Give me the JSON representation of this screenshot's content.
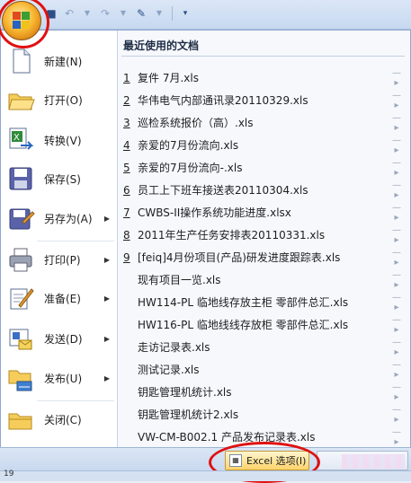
{
  "menu": {
    "items": [
      {
        "label": "新建(N)",
        "icon": "new-document-icon"
      },
      {
        "label": "打开(O)",
        "icon": "open-folder-icon"
      },
      {
        "label": "转换(V)",
        "icon": "convert-icon"
      },
      {
        "label": "保存(S)",
        "icon": "save-disk-icon"
      },
      {
        "label": "另存为(A)",
        "icon": "save-as-icon",
        "submenu": true
      },
      {
        "label": "打印(P)",
        "icon": "printer-icon",
        "submenu": true
      },
      {
        "label": "准备(E)",
        "icon": "prepare-icon",
        "submenu": true
      },
      {
        "label": "发送(D)",
        "icon": "send-icon",
        "submenu": true
      },
      {
        "label": "发布(U)",
        "icon": "publish-icon",
        "submenu": true
      },
      {
        "label": "关闭(C)",
        "icon": "close-folder-icon"
      }
    ]
  },
  "recent": {
    "heading": "最近使用的文档",
    "docs": [
      {
        "num": "1",
        "name": "复件 7月.xls"
      },
      {
        "num": "2",
        "name": "华伟电气内部通讯录20110329.xls"
      },
      {
        "num": "3",
        "name": "巡检系统报价（高）.xls"
      },
      {
        "num": "4",
        "name": "亲爱的7月份流向.xls"
      },
      {
        "num": "5",
        "name": "亲爱的7月份流向-.xls"
      },
      {
        "num": "6",
        "name": "员工上下班车接送表20110304.xls"
      },
      {
        "num": "7",
        "name": "CWBS-II操作系统功能进度.xlsx"
      },
      {
        "num": "8",
        "name": "2011年生产任务安排表20110331.xls"
      },
      {
        "num": "9",
        "name": "[feiq]4月份项目(产品)研发进度跟踪表.xls"
      },
      {
        "num": "",
        "name": "现有项目一览.xls"
      },
      {
        "num": "",
        "name": "HW114-PL  临地线存放主柜 零部件总汇.xls"
      },
      {
        "num": "",
        "name": "HW116-PL  临地线线存放柜 零部件总汇.xls"
      },
      {
        "num": "",
        "name": "走访记录表.xls"
      },
      {
        "num": "",
        "name": "测试记录.xls"
      },
      {
        "num": "",
        "name": "钥匙管理机统计.xls"
      },
      {
        "num": "",
        "name": "钥匙管理机统计2.xls"
      },
      {
        "num": "",
        "name": "VW-CM-B002.1 产品发布记录表.xls"
      }
    ]
  },
  "bottom": {
    "options_label": "Excel 选项(I)"
  },
  "status": {
    "text": "19"
  },
  "colors": {
    "highlight": "#e01010",
    "accent": "#f7b531"
  }
}
